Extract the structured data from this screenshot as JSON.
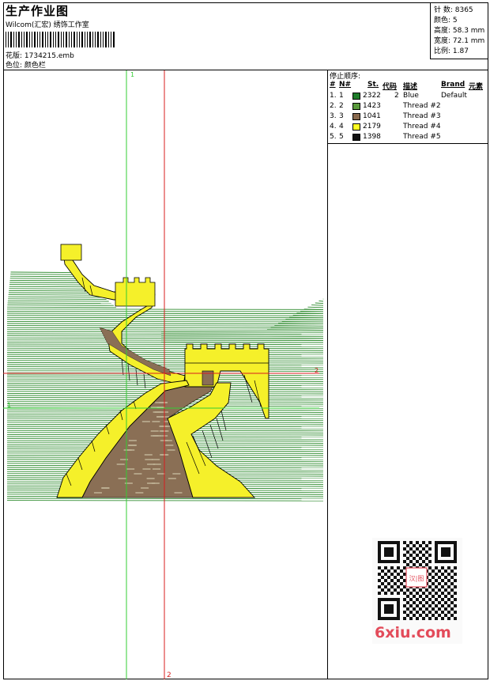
{
  "header": {
    "title": "生产作业图",
    "company": "Wilcom(汇宏) 绣饰工作室",
    "design_line": "花版: 1734215.emb",
    "color_line": "色位: 颜色栏"
  },
  "stats": {
    "stitches": "针 数: 8365",
    "colors": "颜色: 5",
    "height": "高度: 58.3 mm",
    "width": "宽度: 72.1 mm",
    "scale": "比例: 1.87"
  },
  "guides": {
    "green_label": "1",
    "red_label": "2",
    "red_mark": "2",
    "green_mark": "1"
  },
  "thread_table": {
    "title": "停止顺序:",
    "headers": [
      "#",
      "N#",
      "St.",
      "代码",
      "描述",
      "Brand",
      "元素"
    ],
    "rows": [
      {
        "idx": "1.",
        "n": "1",
        "color": "#1e7d2a",
        "st": "2322",
        "code": "2",
        "desc": "Blue",
        "brand": "Default"
      },
      {
        "idx": "2.",
        "n": "2",
        "color": "#5a9a3c",
        "st": "1423",
        "code": "",
        "desc": "Thread #2",
        "brand": ""
      },
      {
        "idx": "3.",
        "n": "3",
        "color": "#8a6a4e",
        "st": "1041",
        "code": "",
        "desc": "Thread #3",
        "brand": ""
      },
      {
        "idx": "4.",
        "n": "4",
        "color": "#ffff22",
        "st": "2179",
        "code": "",
        "desc": "Thread #4",
        "brand": ""
      },
      {
        "idx": "5.",
        "n": "5",
        "color": "#111111",
        "st": "1398",
        "code": "",
        "desc": "Thread #5",
        "brand": ""
      }
    ]
  },
  "watermark": {
    "text": "6xiu.com",
    "stamp": "汉|图"
  },
  "colors": {
    "grass": "#2e8b2e",
    "wall": "#f5f02a",
    "road": "#8a6f55",
    "guide_green": "#33cc33",
    "guide_red": "#d81e1e",
    "watermark": "#e34b5a"
  }
}
